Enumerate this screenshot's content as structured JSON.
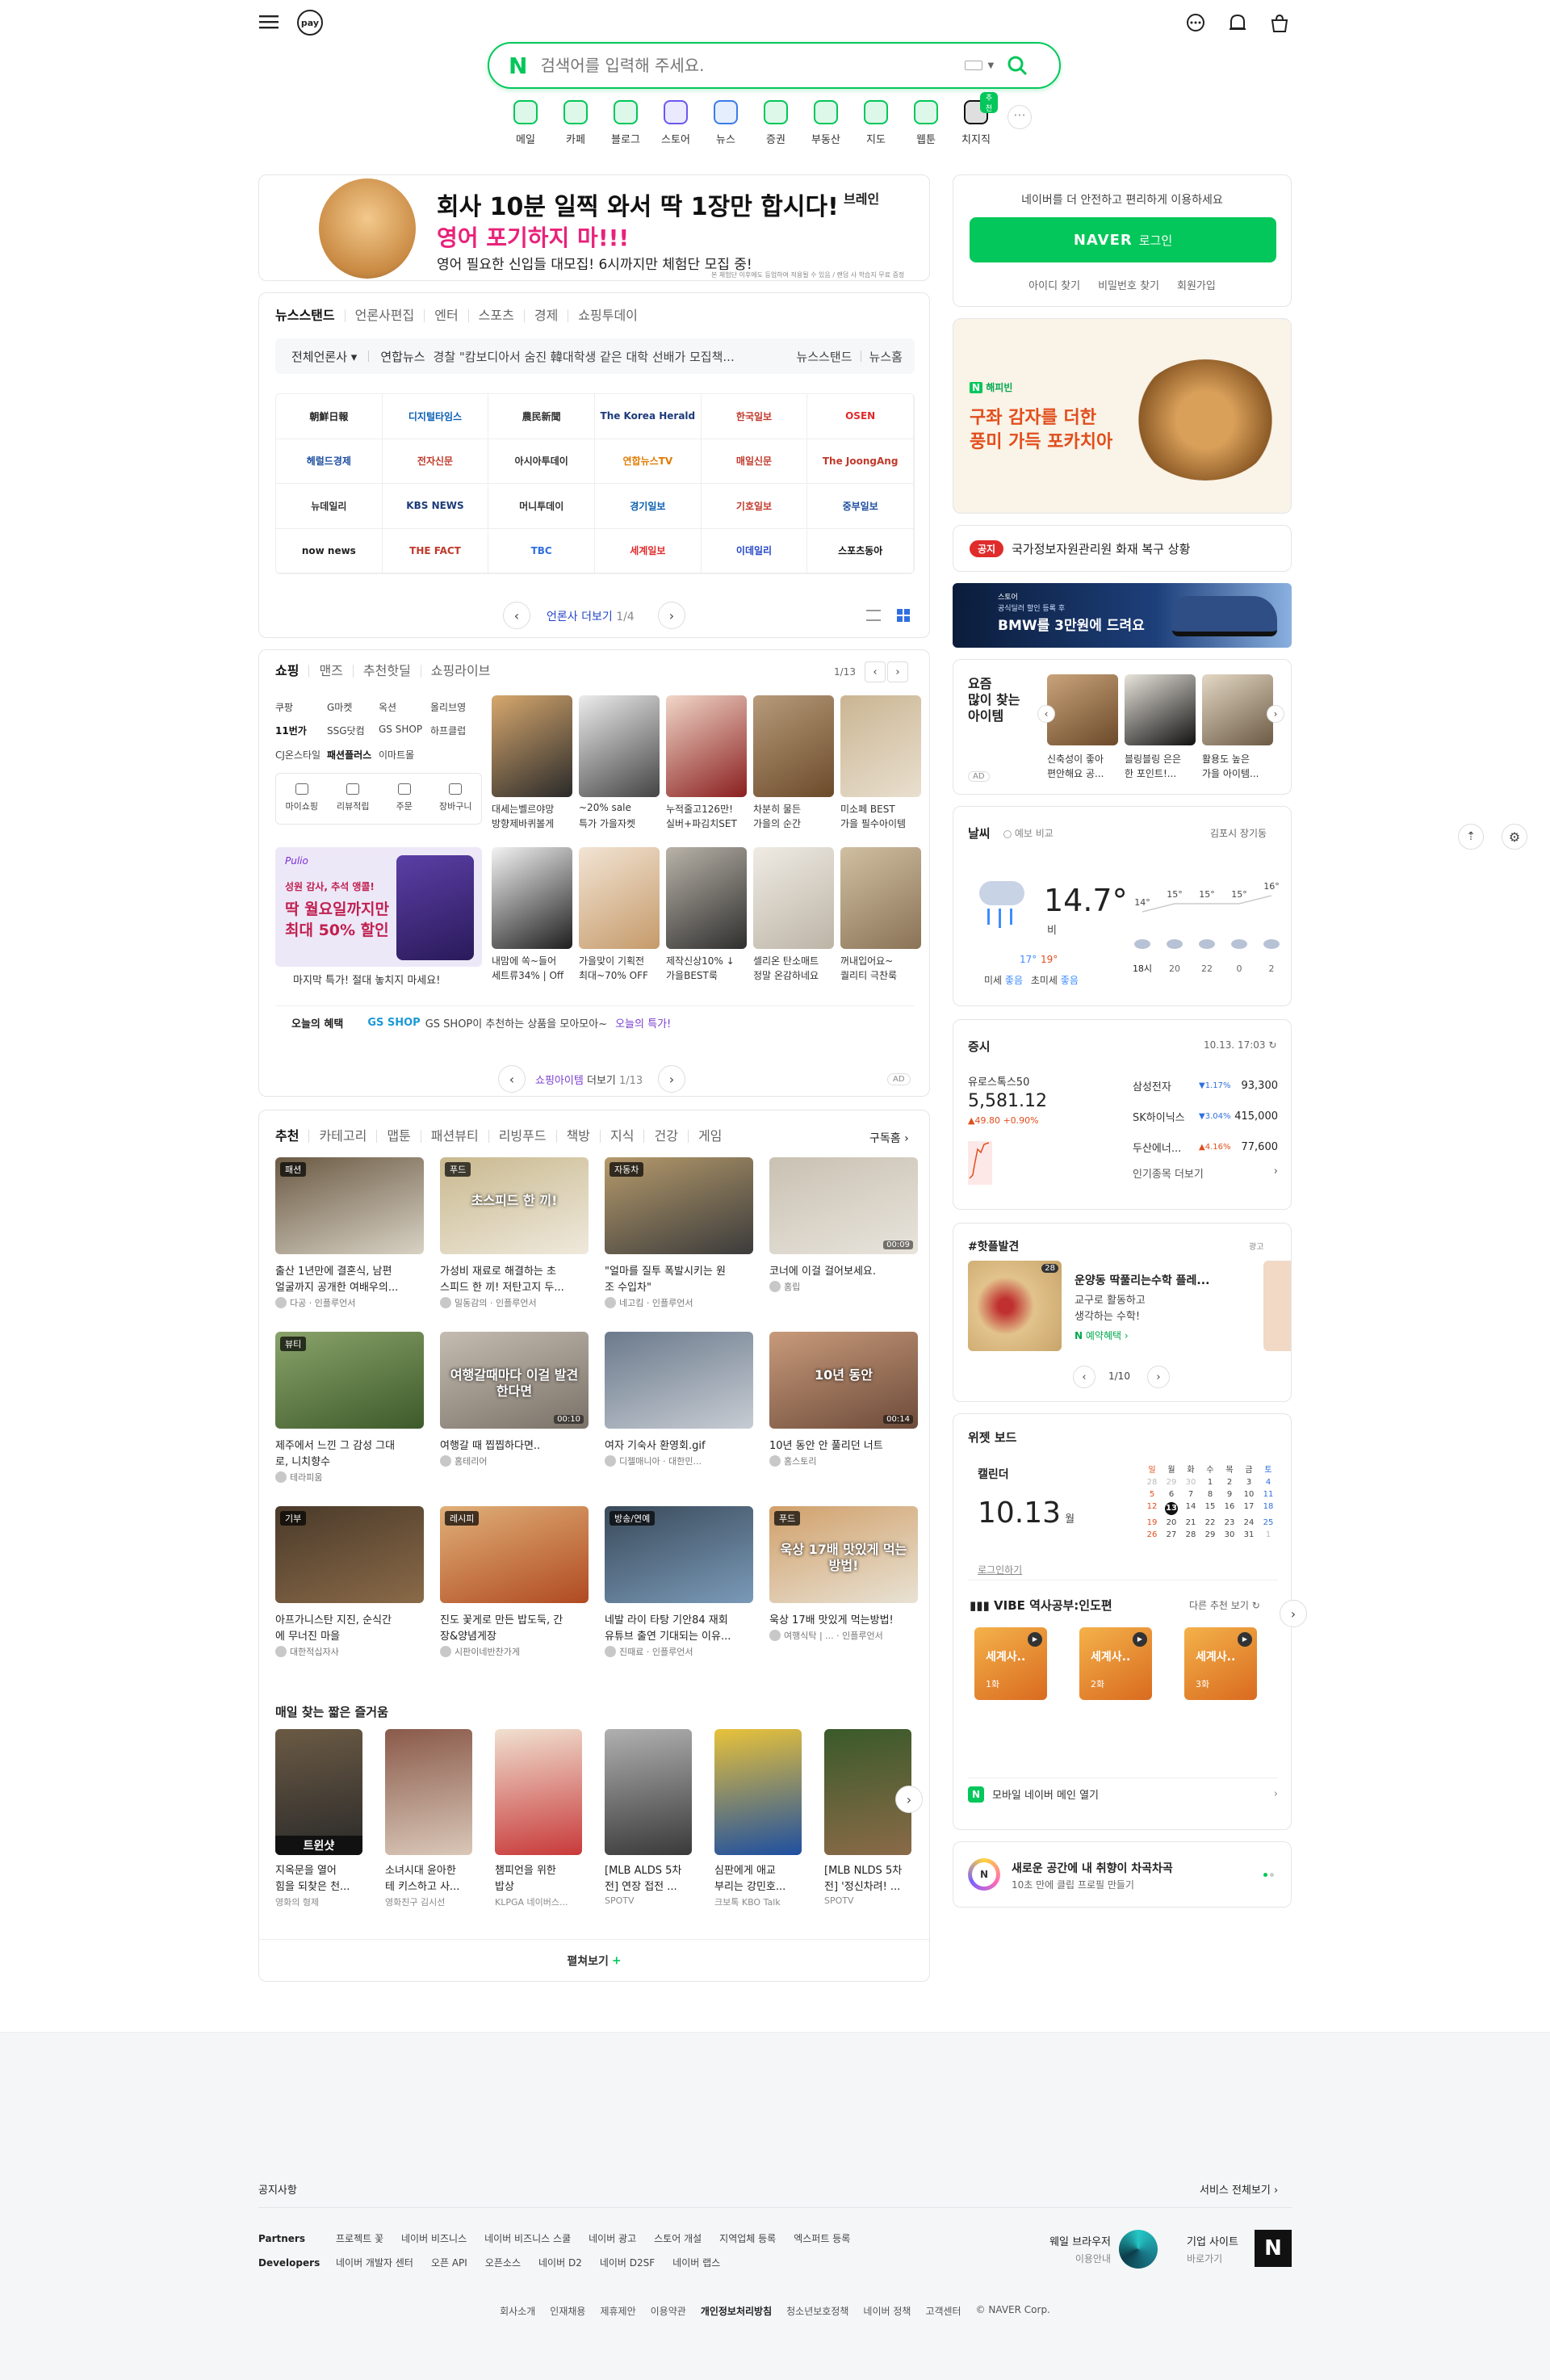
{
  "header": {
    "menu_icon": "hamburger-icon",
    "pay_label": "pay",
    "search_placeholder": "검색어를 입력해 주세요.",
    "search_logo": "N"
  },
  "shortcuts": [
    {
      "label": "메일",
      "icon": "mail-icon",
      "color": "#03c75a"
    },
    {
      "label": "카페",
      "icon": "cafe-icon",
      "color": "#03c75a"
    },
    {
      "label": "블로그",
      "icon": "blog-icon",
      "color": "#03c75a"
    },
    {
      "label": "스토어",
      "icon": "store-icon",
      "color": "#6b57f0"
    },
    {
      "label": "뉴스",
      "icon": "news-icon",
      "color": "#3b7ce8"
    },
    {
      "label": "증권",
      "icon": "stock-icon",
      "color": "#03c75a"
    },
    {
      "label": "부동산",
      "icon": "realestate-icon",
      "color": "#03c75a"
    },
    {
      "label": "지도",
      "icon": "map-icon",
      "color": "#03c75a"
    },
    {
      "label": "웹툰",
      "icon": "webtoon-icon",
      "color": "#03c75a"
    },
    {
      "label": "치지직",
      "icon": "chzzk-icon",
      "color": "#111111"
    }
  ],
  "shortcut_new_badge": "추천",
  "banner": {
    "title": "회사 10분 일찍 와서 딱 1장만 합시다!",
    "sub": "영어 포기하지 마!!!",
    "desc": "영어 필요한 신입들 대모집! 6시까지만 체험단 모집 중!",
    "brand": "브레인",
    "fine": "본 체험단 이후에도 등업하여 적용될 수 있음 / 랜덤 사 학습지 무료 증정"
  },
  "login": {
    "intro": "네이버를 더 안전하고 편리하게 이용하세요",
    "button_brand": "NAVER",
    "button_label": "로그인",
    "links": [
      "아이디 찾기",
      "비밀번호 찾기",
      "회원가입"
    ]
  },
  "newsstand": {
    "tabs": [
      "뉴스스탠드",
      "언론사편집",
      "엔터",
      "스포츠",
      "경제",
      "쇼핑투데이"
    ],
    "filter": "전체언론사",
    "ticker_source": "연합뉴스",
    "ticker": "경찰 \"캄보디아서 숨진 韓대학생 같은 대학 선배가 모집책...",
    "right_links": [
      "뉴스스탠드",
      "뉴스홈"
    ],
    "presses": [
      "朝鮮日報",
      "디지털타임스",
      "農民新聞",
      "The Korea Herald",
      "한국일보",
      "OSEN",
      "헤럴드경제",
      "전자신문",
      "아시아투데이",
      "연합뉴스TV",
      "매일신문",
      "The JoongAng",
      "뉴데일리",
      "KBS NEWS",
      "머니투데이",
      "경기일보",
      "기호일보",
      "중부일보",
      "now news",
      "THE FACT",
      "TBC",
      "세계일보",
      "이데일리",
      "스포츠동아"
    ],
    "more": "언론사 더보기",
    "page": "1/4"
  },
  "hero_ad": {
    "brand": "해피빈",
    "line1": "구좌 감자를 더한",
    "line2": "풍미 가득 포카치아"
  },
  "notice": {
    "tag": "공지",
    "text": "국가정보자원관리원 화재 복구 상황"
  },
  "bmw_ad": {
    "brand": "스토어",
    "line1": "공식딜러 할인 등록 후",
    "line2": "BMW를 3만원에 드려요"
  },
  "shopping": {
    "tabs": [
      "쇼핑",
      "맨즈",
      "추천핫딜",
      "쇼핑라이브"
    ],
    "page": "1/13",
    "stores": [
      "쿠팡",
      "G마켓",
      "옥션",
      "올리브영",
      "11번가",
      "SSG닷컴",
      "GS SHOP",
      "하프클럽",
      "CJ온스타일",
      "패션플러스",
      "이마트몰"
    ],
    "my": [
      "마이쇼핑",
      "리뷰적립",
      "주문",
      "장바구니"
    ],
    "promo_brand": "Pulio",
    "promo_top": "성원 감사, 추석 앵콜!",
    "promo_title1": "딱 월요일까지만",
    "promo_title2": "최대 50% 할인",
    "promo_cap": "마지막 특가! 절대 놓치지 마세요!",
    "row1": [
      {
        "c1": "대세는벨르야망",
        "c2": "방향제바퀴볼게"
      },
      {
        "c1": "~20% sale",
        "c2": "특가 가을자켓"
      },
      {
        "c1": "누적줄고126만!",
        "c2": "실버+파김치SET"
      },
      {
        "c1": "차분히 물든",
        "c2": "가을의 순간"
      },
      {
        "c1": "미소페 BEST",
        "c2": "가을 필수아이템"
      }
    ],
    "row2": [
      {
        "c1": "내맘에 쏙~들어",
        "c2": "세트류34% | Off"
      },
      {
        "c1": "가을맞이 기획전",
        "c2": "최대~70% OFF"
      },
      {
        "c1": "제작신상10% ↓",
        "c2": "가을BEST룩"
      },
      {
        "c1": "셀리온 탄소매트",
        "c2": "정말 온감하네요"
      },
      {
        "c1": "꺼내입어요~",
        "c2": "퀄리티 극찬룩"
      }
    ],
    "benefit_label": "오늘의 혜택",
    "benefit_brand": "GS SHOP",
    "benefit_text": "GS SHOP이 추천하는 상품을 모아모아~",
    "benefit_link": "오늘의 특가!",
    "more": "쇼핑아이템",
    "more2": "더보기",
    "more_page": "1/13",
    "ad": "AD"
  },
  "popular": {
    "title1": "요즘",
    "title2": "많이 찾는",
    "title3": "아이템",
    "ad": "AD",
    "items": [
      {
        "c1": "신축성이 좋아",
        "c2": "편안해요 공..."
      },
      {
        "c1": "블링블링 은은",
        "c2": "한 포인트!..."
      },
      {
        "c1": "활용도 높은",
        "c2": "가을 아이템..."
      }
    ]
  },
  "weather": {
    "title": "날씨",
    "compare": "예보 비교",
    "location": "김포시 장기동",
    "temp": "14.7°",
    "condition": "비",
    "low": "17°",
    "high": "19°",
    "dust1": "미세",
    "dust1v": "좋음",
    "dust2": "초미세",
    "dust2v": "좋음",
    "hours": [
      "18시",
      "20",
      "22",
      "0",
      "2"
    ],
    "hour_temps": [
      14,
      15,
      15,
      15,
      16
    ]
  },
  "stock": {
    "title": "증시",
    "time": "10.13. 17:03",
    "index_name": "유로스톡스50",
    "index_value": "5,581.12",
    "index_change": "▲49.80 +0.90%",
    "rows": [
      {
        "name": "삼성전자",
        "change": "▼1.17%",
        "price": "93,300",
        "dir": "down"
      },
      {
        "name": "SK하이닉스",
        "change": "▼3.04%",
        "price": "415,000",
        "dir": "down"
      },
      {
        "name": "두산에너...",
        "change": "▲4.16%",
        "price": "77,600",
        "dir": "up"
      }
    ],
    "more": "인기종목 더보기"
  },
  "hotplace": {
    "title": "#핫플발견",
    "ad": "광고",
    "name": "운양동 딱풀리는수학 플레...",
    "d1": "교구로 활동하고",
    "d2": "생각하는 수학!",
    "cta": "예약혜택",
    "page": "1/10",
    "badge": "28"
  },
  "feed": {
    "tabs": [
      "추천",
      "카테고리",
      "맵툰",
      "패션뷰티",
      "리빙푸드",
      "책방",
      "지식",
      "건강",
      "게임"
    ],
    "subscribe": "구독홈",
    "rows": [
      [
        {
          "badge": "패션",
          "c1": "출산 1년만에 결혼식, 남편",
          "c2": "얼굴까지 공개한 여배우의...",
          "by": "다공 · 인플루언서"
        },
        {
          "badge": "푸드",
          "c1": "가성비 재료로 해결하는 초",
          "c2": "스피드 한 끼! 저탄고지 두...",
          "by": "밀동감의 · 인플루언서",
          "overlay": "초스피드 한 끼!"
        },
        {
          "badge": "자동차",
          "c1": "\"얼마를 질투 폭발시키는 원",
          "c2": "조 수입차\"",
          "by": "네고킴 · 인플루언서"
        },
        {
          "badge": "",
          "c1": "코너에 이걸 걸어보세요.",
          "c2": "",
          "by": "홈립",
          "time": "00:09"
        }
      ],
      [
        {
          "badge": "뷰티",
          "c1": "제주에서 느낀 그 감성 그대",
          "c2": "로, 니치향수",
          "by": "테라피움"
        },
        {
          "badge": "",
          "c1": "여행갈 때 찝찝하다면..",
          "c2": "",
          "by": "홈테리어",
          "overlay": "여행갈때마다 이걸 발견한다면",
          "time": "00:10"
        },
        {
          "badge": "",
          "c1": "여자 기숙사 환영회.gif",
          "c2": "",
          "by": "디젤매니아 · 대한민..."
        },
        {
          "badge": "",
          "c1": "10년 동안 안 풀리던 너트",
          "c2": "",
          "by": "홈스토리",
          "overlay": "10년 동안",
          "time": "00:14"
        }
      ],
      [
        {
          "badge": "기부",
          "c1": "아프가니스탄 지진, 순식간",
          "c2": "에 무너진 마을",
          "by": "대한적십자사"
        },
        {
          "badge": "레시피",
          "c1": "진도 꽃게로 만든 밥도둑, 간",
          "c2": "장&양념게장",
          "by": "시판이네반찬가게"
        },
        {
          "badge": "방송/연예",
          "c1": "네발 라이 타탕 기안84 재회",
          "c2": "유튜브 출연 기대되는 이유...",
          "by": "진때료 · 인플루언서"
        },
        {
          "badge": "푸드",
          "c1": "욱상 17배 맛있게 먹는방법!",
          "c2": "",
          "by": "여행식탁 | ... · 인플루언서",
          "overlay": "욱상 17배 맛있게 먹는 방법!"
        }
      ]
    ],
    "clips_title": "매일 찾는 짧은 즐거움",
    "clips": [
      {
        "c1": "지옥문을 열어",
        "c2": "힘을 되찾은 천...",
        "by": "영화의 형제",
        "overlay": "트윈샷"
      },
      {
        "c1": "소녀시대 윤아한",
        "c2": "테 키스하고 사...",
        "by": "영화친구 김시선"
      },
      {
        "c1": "챔피언을 위한",
        "c2": "밥상",
        "by": "KLPGA 네이버스..."
      },
      {
        "c1": "[MLB ALDS 5차",
        "c2": "전] 연장 접전 ...",
        "by": "SPOTV"
      },
      {
        "c1": "심판에게 애교",
        "c2": "부리는 강민호...",
        "by": "크보톡 KBO Talk"
      },
      {
        "c1": "[MLB NLDS 5차",
        "c2": "전] '정신차려! ...",
        "by": "SPOTV"
      }
    ],
    "expand": "펼쳐보기"
  },
  "widget": {
    "title": "위젯 보드",
    "cal_title": "캘린더",
    "cal_date": "10.13",
    "cal_weekday": "월",
    "cal_login": "로그인하기",
    "week": [
      "일",
      "월",
      "화",
      "수",
      "목",
      "금",
      "토"
    ],
    "days": [
      [
        "28",
        "29",
        "30",
        "1",
        "2",
        "3",
        "4"
      ],
      [
        "5",
        "6",
        "7",
        "8",
        "9",
        "10",
        "11"
      ],
      [
        "12",
        "13",
        "14",
        "15",
        "16",
        "17",
        "18"
      ],
      [
        "19",
        "20",
        "21",
        "22",
        "23",
        "24",
        "25"
      ],
      [
        "26",
        "27",
        "28",
        "29",
        "30",
        "31",
        "1"
      ]
    ],
    "vibe_logo": "VIBE",
    "vibe_title": "역사공부:인도편",
    "vibe_more": "다른 추천 보기",
    "vibe_covers": [
      {
        "t": "세계사..",
        "n": "1화"
      },
      {
        "t": "세계사..",
        "n": "2화"
      },
      {
        "t": "세계사..",
        "n": "3화"
      }
    ],
    "mobile": "모바일 네이버 메인 열기"
  },
  "club": {
    "title": "새로운 공간에 내 취향이 차곡차곡",
    "sub": "10초 만에 클립 프로필 만들기"
  },
  "footer": {
    "notice": "공지사항",
    "all_services": "서비스 전체보기",
    "partners_label": "Partners",
    "partners": [
      "프로젝트 꽃",
      "네이버 비즈니스",
      "네이버 비즈니스 스쿨",
      "네이버 광고",
      "스토어 개설",
      "지역업체 등록",
      "엑스퍼트 등록"
    ],
    "dev_label": "Developers",
    "devs": [
      "네이버 개발자 센터",
      "오픈 API",
      "오픈소스",
      "네이버 D2",
      "네이버 D2SF",
      "네이버 랩스"
    ],
    "whale": "웨일 브라우저",
    "whale_sub": "이용안내",
    "corp": "기업 사이트",
    "corp_sub": "바로가기",
    "bottom": [
      "회사소개",
      "인재채용",
      "제휴제안",
      "이용약관",
      "개인정보처리방침",
      "청소년보호정책",
      "네이버 정책",
      "고객센터",
      "© NAVER Corp."
    ]
  }
}
